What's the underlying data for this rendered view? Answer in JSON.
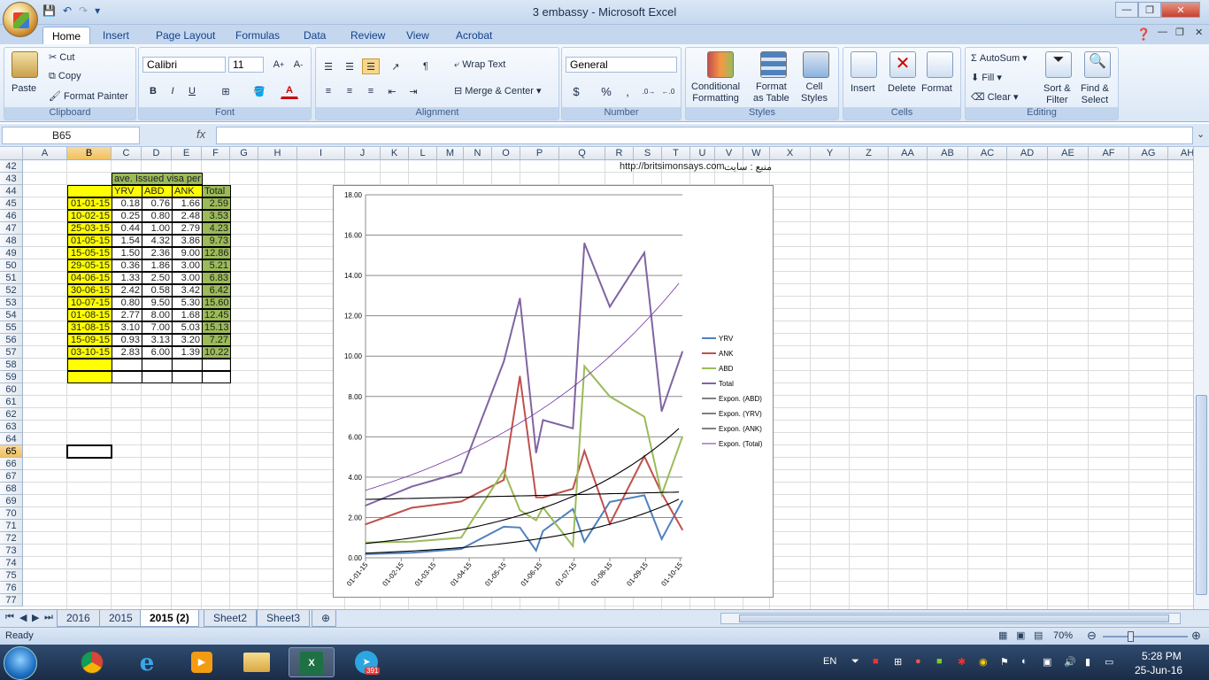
{
  "window": {
    "title": "3 embassy - Microsoft Excel"
  },
  "ribbon_tabs": [
    "Home",
    "Insert",
    "Page Layout",
    "Formulas",
    "Data",
    "Review",
    "View",
    "Acrobat"
  ],
  "clipboard": {
    "paste": "Paste",
    "cut": "Cut",
    "copy": "Copy",
    "format_painter": "Format Painter",
    "label": "Clipboard"
  },
  "font": {
    "name": "Calibri",
    "size": "11",
    "bold": "B",
    "italic": "I",
    "underline": "U",
    "label": "Font"
  },
  "alignment": {
    "wrap": "Wrap Text",
    "merge": "Merge & Center",
    "label": "Alignment"
  },
  "number": {
    "format": "General",
    "currency": "$",
    "percent": "%",
    "comma": ",",
    "label": "Number"
  },
  "styles": {
    "conditional": "Conditional\nFormatting",
    "format_table": "Format\nas Table",
    "cell_styles": "Cell\nStyles",
    "label": "Styles"
  },
  "cells": {
    "insert": "Insert",
    "delete": "Delete",
    "format": "Format",
    "label": "Cells"
  },
  "editing": {
    "autosum": "AutoSum",
    "fill": "Fill",
    "clear": "Clear",
    "sort": "Sort &\nFilter",
    "find": "Find &\nSelect",
    "label": "Editing"
  },
  "formula_bar": {
    "name_box": "B65",
    "fx": "fx",
    "content": ""
  },
  "columns": [
    "A",
    "B",
    "C",
    "D",
    "E",
    "F",
    "G",
    "H",
    "I",
    "J",
    "K",
    "L",
    "M",
    "N",
    "O",
    "P",
    "Q",
    "R",
    "S",
    "T",
    "U",
    "V",
    "W",
    "X",
    "Y",
    "Z",
    "AA",
    "AB",
    "AC",
    "AD",
    "AE",
    "AF",
    "AG",
    "AH"
  ],
  "rows": [
    42,
    43,
    44,
    45,
    46,
    47,
    48,
    49,
    50,
    51,
    52,
    53,
    54,
    55,
    56,
    57,
    58,
    59,
    60,
    61,
    62,
    63,
    64,
    65,
    66,
    67,
    68,
    69,
    70,
    71,
    72,
    73,
    74,
    75,
    76,
    77
  ],
  "table": {
    "title": "ave. Issued visa per day",
    "headers": [
      "YRV",
      "ABD",
      "ANK",
      "Total"
    ],
    "rows": [
      [
        "01-01-15",
        "0.18",
        "0.76",
        "1.66",
        "2.59"
      ],
      [
        "10-02-15",
        "0.25",
        "0.80",
        "2.48",
        "3.53"
      ],
      [
        "25-03-15",
        "0.44",
        "1.00",
        "2.79",
        "4.23"
      ],
      [
        "01-05-15",
        "1.54",
        "4.32",
        "3.86",
        "9.73"
      ],
      [
        "15-05-15",
        "1.50",
        "2.36",
        "9.00",
        "12.86"
      ],
      [
        "29-05-15",
        "0.36",
        "1.86",
        "3.00",
        "5.21"
      ],
      [
        "04-06-15",
        "1.33",
        "2.50",
        "3.00",
        "6.83"
      ],
      [
        "30-06-15",
        "2.42",
        "0.58",
        "3.42",
        "6.42"
      ],
      [
        "10-07-15",
        "0.80",
        "9.50",
        "5.30",
        "15.60"
      ],
      [
        "01-08-15",
        "2.77",
        "8.00",
        "1.68",
        "12.45"
      ],
      [
        "31-08-15",
        "3.10",
        "7.00",
        "5.03",
        "15.13"
      ],
      [
        "15-09-15",
        "0.93",
        "3.13",
        "3.20",
        "7.27"
      ],
      [
        "03-10-15",
        "2.83",
        "6.00",
        "1.39",
        "10.22"
      ]
    ]
  },
  "cell_text": {
    "url": "http://britsimonsays.com",
    "source": "منبع : سایت"
  },
  "chart_data": {
    "type": "line",
    "x": [
      "01-01-15",
      "10-02-15",
      "25-03-15",
      "01-05-15",
      "15-05-15",
      "29-05-15",
      "04-06-15",
      "30-06-15",
      "10-07-15",
      "01-08-15",
      "31-08-15",
      "15-09-15",
      "03-10-15"
    ],
    "x_tick_labels": [
      "01-01-15",
      "01-02-15",
      "01-03-15",
      "01-04-15",
      "01-05-15",
      "01-06-15",
      "01-07-15",
      "01-08-15",
      "01-09-15",
      "01-10-15"
    ],
    "ylim": [
      0,
      18
    ],
    "y_ticks": [
      "0.00",
      "2.00",
      "4.00",
      "6.00",
      "8.00",
      "10.00",
      "12.00",
      "14.00",
      "16.00",
      "18.00"
    ],
    "grid": true,
    "legend_position": "right",
    "series": [
      {
        "name": "YRV",
        "color": "#4f81bd",
        "values": [
          0.18,
          0.25,
          0.44,
          1.54,
          1.5,
          0.36,
          1.33,
          2.42,
          0.8,
          2.77,
          3.1,
          0.93,
          2.83
        ]
      },
      {
        "name": "ANK",
        "color": "#c0504d",
        "values": [
          1.66,
          2.48,
          2.79,
          3.86,
          9.0,
          3.0,
          3.0,
          3.42,
          5.3,
          1.68,
          5.03,
          3.2,
          1.39
        ]
      },
      {
        "name": "ABD",
        "color": "#9bbb59",
        "values": [
          0.76,
          0.8,
          1.0,
          4.32,
          2.36,
          1.86,
          2.5,
          0.58,
          9.5,
          8.0,
          7.0,
          3.13,
          6.0
        ]
      },
      {
        "name": "Total",
        "color": "#8064a2",
        "values": [
          2.59,
          3.53,
          4.23,
          9.73,
          12.86,
          5.21,
          6.83,
          6.42,
          15.6,
          12.45,
          15.13,
          7.27,
          10.22
        ]
      }
    ],
    "trendlines": [
      {
        "name": "Expon. (ABD)",
        "color": "#000000"
      },
      {
        "name": "Expon. (YRV)",
        "color": "#000000"
      },
      {
        "name": "Expon. (ANK)",
        "color": "#000000"
      },
      {
        "name": "Expon. (Total)",
        "color": "#7030a0"
      }
    ]
  },
  "sheet_tabs": [
    "2016",
    "2015",
    "2015 (2)",
    "Sheet2",
    "Sheet3"
  ],
  "status": {
    "ready": "Ready",
    "zoom": "70%"
  },
  "taskbar": {
    "lang": "EN",
    "time": "5:28 PM",
    "date": "25-Jun-16",
    "telegram_badge": "391"
  }
}
